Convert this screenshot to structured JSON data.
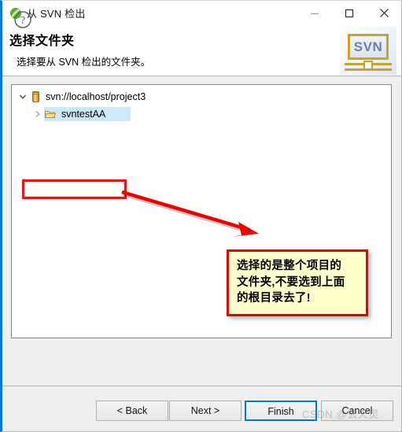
{
  "window": {
    "title": "从 SVN 检出",
    "app_icon": "svn-subclipse-icon",
    "controls": {
      "minimize": "minimize-icon",
      "maximize": "maximize-icon",
      "close": "close-icon"
    }
  },
  "header": {
    "title": "选择文件夹",
    "subtitle": "选择要从 SVN 检出的文件夹。",
    "logo_text": "SVN",
    "logo_accent": "#c9a227"
  },
  "tree": {
    "nodes": [
      {
        "label": "svn://localhost/project3",
        "icon": "repository-icon",
        "twisty": "chevron-down-icon",
        "expanded": true,
        "selected": false
      },
      {
        "label": "svntestAA",
        "icon": "folder-open-icon",
        "twisty": "chevron-right-icon",
        "expanded": false,
        "selected": true
      }
    ],
    "selection_color": "#cde8f6"
  },
  "annotation": {
    "highlight_color": "#ee1111",
    "arrow_color": "#ee0000",
    "callout_text": "选择的是整个项目的\n文件夹,不要选到上面\n的根目录去了!",
    "callout_bg": "#ffffcc",
    "callout_border": "#ee0000"
  },
  "footer": {
    "help": "help-icon",
    "buttons": [
      {
        "label": "< Back",
        "name": "back-button",
        "primary": false
      },
      {
        "label": "Next >",
        "name": "next-button",
        "primary": false
      },
      {
        "label": "Finish",
        "name": "finish-button",
        "primary": true
      },
      {
        "label": "Cancel",
        "name": "cancel-button",
        "primary": false
      }
    ],
    "accent": "#0078d7"
  },
  "watermark": {
    "text": "CSDN @玄天灵"
  }
}
